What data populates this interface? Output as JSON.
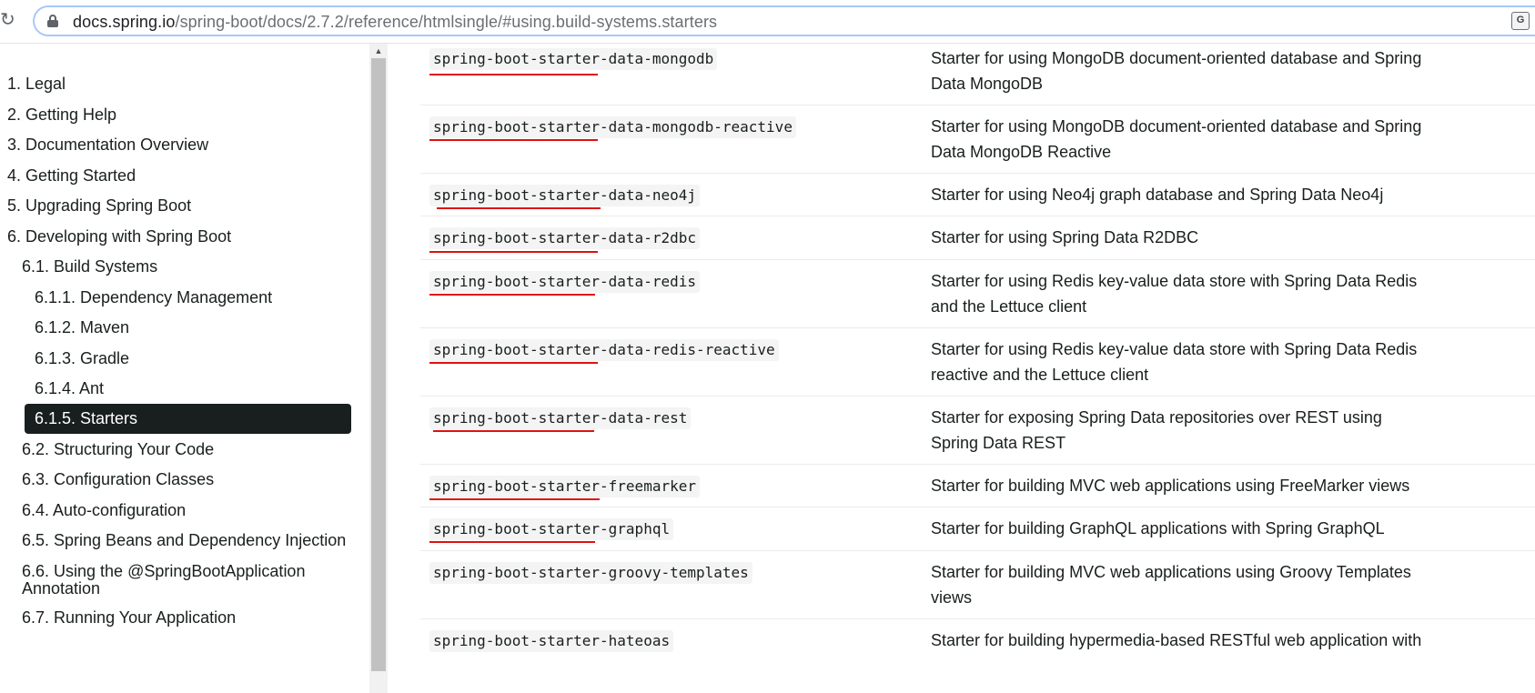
{
  "browser": {
    "url_host": "docs.spring.io",
    "url_path": "/spring-boot/docs/2.7.2/reference/htmlsingle/#using.build-systems.starters",
    "translate_label": "G"
  },
  "toc": [
    {
      "label": "1. Legal"
    },
    {
      "label": "2. Getting Help"
    },
    {
      "label": "3. Documentation Overview"
    },
    {
      "label": "4. Getting Started"
    },
    {
      "label": "5. Upgrading Spring Boot"
    },
    {
      "label": "6. Developing with Spring Boot"
    },
    {
      "label": "6.1. Build Systems"
    },
    {
      "label": "6.1.1. Dependency Management"
    },
    {
      "label": "6.1.2. Maven"
    },
    {
      "label": "6.1.3. Gradle"
    },
    {
      "label": "6.1.4. Ant"
    },
    {
      "label": "6.1.5. Starters"
    },
    {
      "label": "6.2. Structuring Your Code"
    },
    {
      "label": "6.3. Configuration Classes"
    },
    {
      "label": "6.4. Auto-configuration"
    },
    {
      "label": "6.5. Spring Beans and Dependency Injection"
    },
    {
      "label": "6.6. Using the @SpringBootApplication Annotation"
    },
    {
      "label": "6.7. Running Your Application"
    }
  ],
  "starters": [
    {
      "name": "spring-boot-starter-data-mongodb",
      "description": "Starter for using MongoDB document-oriented database and Spring Data MongoDB"
    },
    {
      "name": "spring-boot-starter-data-mongodb-reactive",
      "description": "Starter for using MongoDB document-oriented database and Spring Data MongoDB Reactive"
    },
    {
      "name": "spring-boot-starter-data-neo4j",
      "description": "Starter for using Neo4j graph database and Spring Data Neo4j"
    },
    {
      "name": "spring-boot-starter-data-r2dbc",
      "description": "Starter for using Spring Data R2DBC"
    },
    {
      "name": "spring-boot-starter-data-redis",
      "description": "Starter for using Redis key-value data store with Spring Data Redis and the Lettuce client"
    },
    {
      "name": "spring-boot-starter-data-redis-reactive",
      "description": "Starter for using Redis key-value data store with Spring Data Redis reactive and the Lettuce client"
    },
    {
      "name": "spring-boot-starter-data-rest",
      "description": "Starter for exposing Spring Data repositories over REST using Spring Data REST"
    },
    {
      "name": "spring-boot-starter-freemarker",
      "description": "Starter for building MVC web applications using FreeMarker views"
    },
    {
      "name": "spring-boot-starter-graphql",
      "description": "Starter for building GraphQL applications with Spring GraphQL"
    },
    {
      "name": "spring-boot-starter-groovy-templates",
      "description": "Starter for building MVC web applications using Groovy Templates views"
    },
    {
      "name": "spring-boot-starter-hateoas",
      "description": "Starter for building hypermedia-based RESTful web application with"
    }
  ],
  "colors": {
    "accent_active_bg": "#191e1e",
    "annotation_underline": "#e01010"
  }
}
